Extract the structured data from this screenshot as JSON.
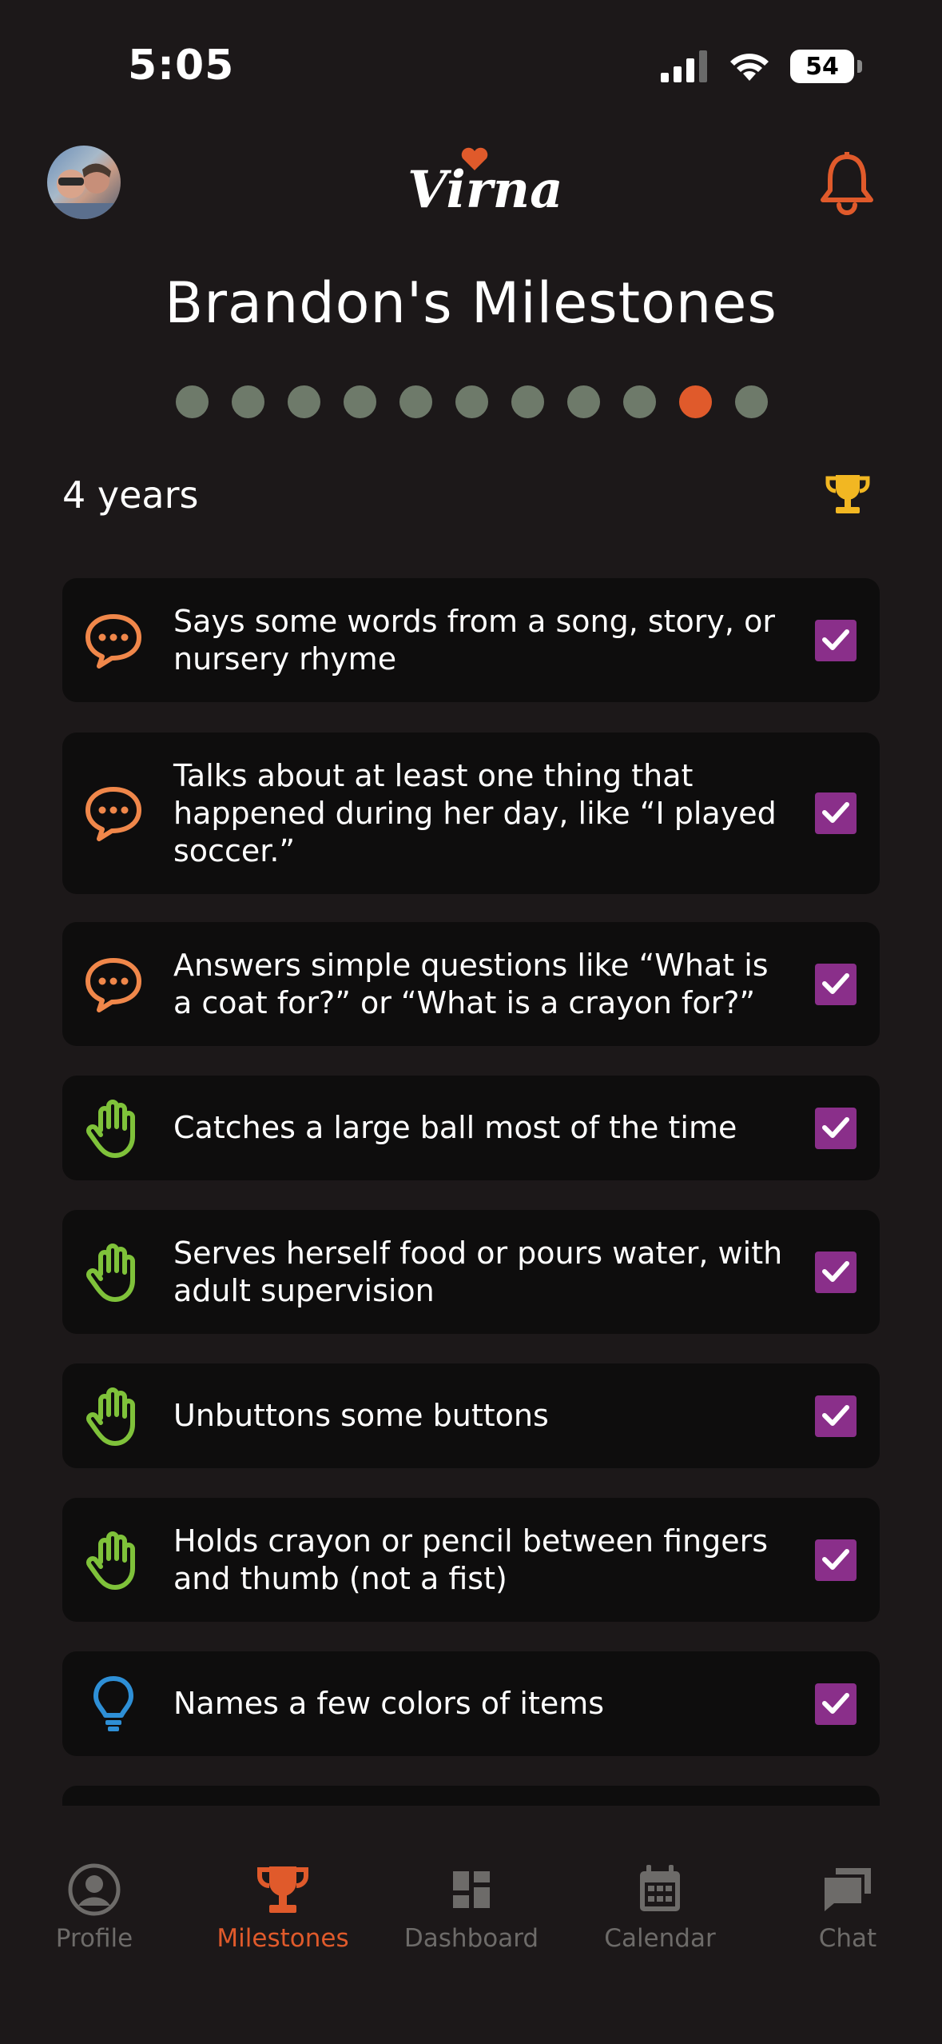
{
  "status": {
    "time": "5:05",
    "battery": "54"
  },
  "header": {
    "logo_text": "Virna",
    "icons": [
      "profile-avatar",
      "heart-icon",
      "bell-icon"
    ]
  },
  "page": {
    "title": "Brandon's Milestones",
    "dots_total": 11,
    "dots_active_index": 9,
    "age_label": "4 years"
  },
  "colors": {
    "accent": "#e05a2b",
    "dot_inactive": "#6e7a6a",
    "checkbox": "#8a2f8a",
    "trophy": "#f2b722",
    "speech_icon": "#f0874a",
    "hand_icon": "#7fc23a",
    "bulb_icon": "#2e8fd6"
  },
  "milestones": [
    {
      "text": "Says some words from a song, story, or nursery rhyme",
      "icon": "speech-bubble-icon",
      "checked": true
    },
    {
      "text": "Talks about at least one thing that happened during her day, like “I played soccer.”",
      "icon": "speech-bubble-icon",
      "checked": true
    },
    {
      "text": "Answers simple questions like “What is a coat for?” or “What is a crayon for?”",
      "icon": "speech-bubble-icon",
      "checked": true
    },
    {
      "text": "Catches a large ball most of the time",
      "icon": "hand-icon",
      "checked": true
    },
    {
      "text": "Serves herself food or pours water, with adult supervision",
      "icon": "hand-icon",
      "checked": true
    },
    {
      "text": "Unbuttons some buttons",
      "icon": "hand-icon",
      "checked": true
    },
    {
      "text": "Holds crayon or pencil between fingers and thumb (not a fist)",
      "icon": "hand-icon",
      "checked": true
    },
    {
      "text": "Names a few colors of items",
      "icon": "lightbulb-icon",
      "checked": true
    }
  ],
  "tabs": [
    {
      "label": "Profile",
      "icon": "profile-icon",
      "active": false
    },
    {
      "label": "Milestones",
      "icon": "trophy-icon",
      "active": true
    },
    {
      "label": "Dashboard",
      "icon": "dashboard-icon",
      "active": false
    },
    {
      "label": "Calendar",
      "icon": "calendar-icon",
      "active": false
    },
    {
      "label": "Chat",
      "icon": "chat-icon",
      "active": false
    }
  ]
}
